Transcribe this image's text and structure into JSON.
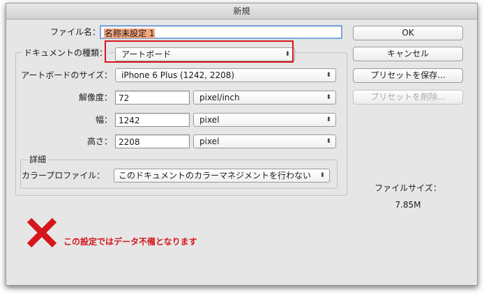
{
  "window": {
    "title": "新規"
  },
  "form": {
    "file_name": {
      "label": "ファイル名：",
      "value": "名称未設定 1"
    },
    "document_type": {
      "label": "ドキュメントの種類：",
      "value": "アートボード"
    },
    "artboard_size": {
      "label": "アートボードのサイズ：",
      "value": "iPhone 6 Plus (1242, 2208)"
    },
    "resolution": {
      "label": "解像度：",
      "value": "72",
      "unit": "pixel/inch"
    },
    "width": {
      "label": "幅：",
      "value": "1242",
      "unit": "pixel"
    },
    "height": {
      "label": "高さ：",
      "value": "2208",
      "unit": "pixel"
    },
    "advanced": {
      "title": "詳細",
      "color_profile": {
        "label": "カラープロファイル：",
        "value": "このドキュメントのカラーマネジメントを行わない"
      }
    }
  },
  "buttons": {
    "ok": "OK",
    "cancel": "キャンセル",
    "save_preset": "プリセットを保存...",
    "delete_preset": "プリセットを削除..."
  },
  "file_size": {
    "label": "ファイルサイズ：",
    "value": "7.85M"
  },
  "annotation": {
    "text": "この設定ではデータ不備となります",
    "color": "#d4161c"
  },
  "icons": {
    "select_arrow": "⬍",
    "error_mark": "red-x-icon"
  }
}
